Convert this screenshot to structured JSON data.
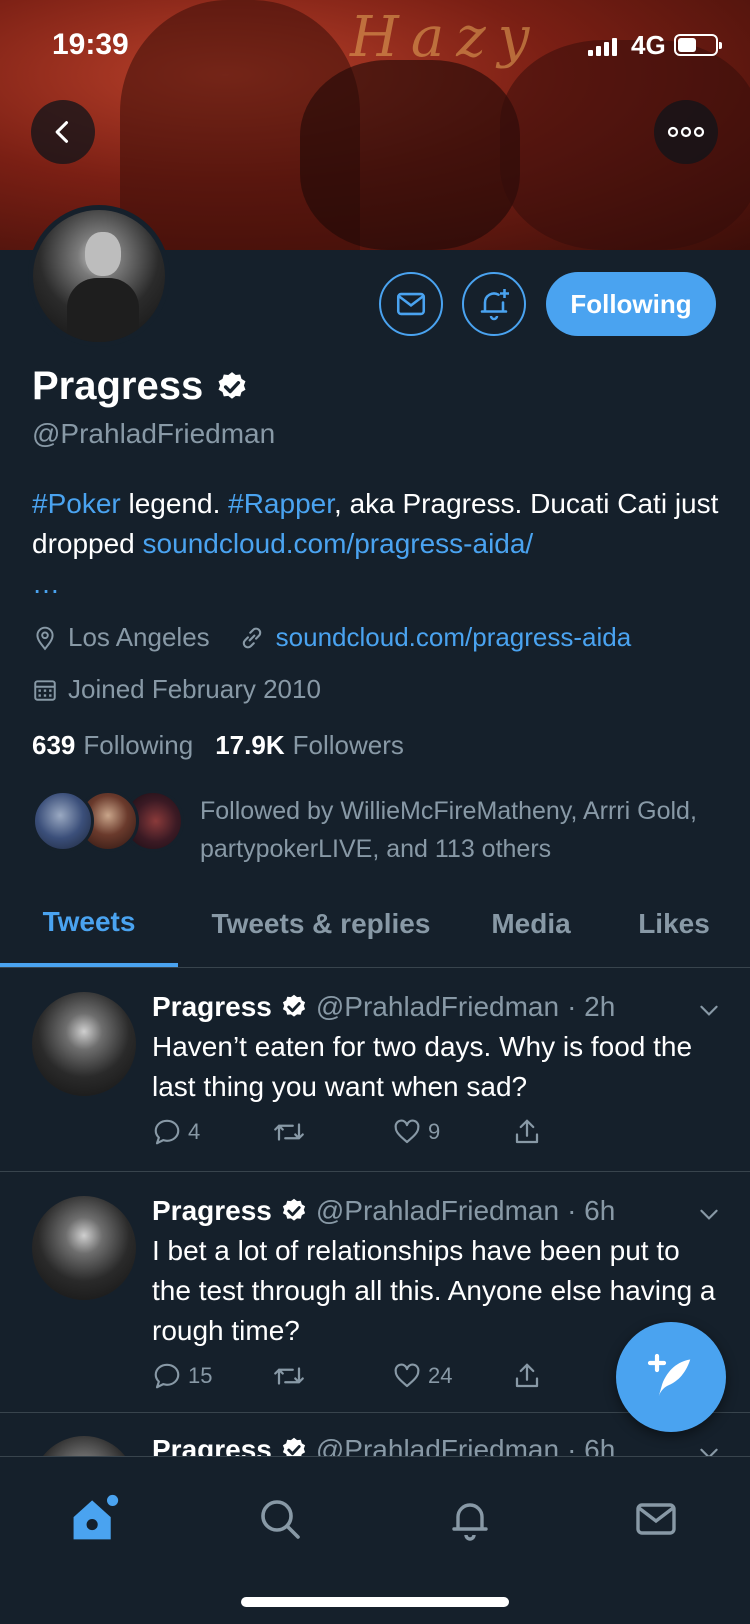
{
  "status_bar": {
    "time": "19:39",
    "network": "4G"
  },
  "profile": {
    "name": "Pragress",
    "handle": "@PrahladFriedman",
    "follow_button": "Following",
    "bio": {
      "hashtag1": "#Poker",
      "text1": " legend. ",
      "hashtag2": "#Rapper",
      "text2": ", aka Pragress. Ducati Cati just dropped ",
      "link": "soundcloud.com/pragress-aida/",
      "ellipsis": "…"
    },
    "location": "Los Angeles",
    "website": "soundcloud.com/pragress-aida",
    "joined": "Joined February 2010",
    "following_count": "639",
    "following_label": "Following",
    "followers_count": "17.9K",
    "followers_label": "Followers",
    "followed_by": "Followed by WillieMcFireMatheny, Arrri Gold, partypokerLIVE, and 113 others"
  },
  "tabs": [
    "Tweets",
    "Tweets & replies",
    "Media",
    "Likes"
  ],
  "tweets": [
    {
      "name": "Pragress",
      "handle": "@PrahladFriedman",
      "time": "· 2h",
      "text": "Haven’t eaten for two days. Why is food the last thing you want when sad?",
      "replies": "4",
      "retweets": "",
      "likes": "9"
    },
    {
      "name": "Pragress",
      "handle": "@PrahladFriedman",
      "time": "· 6h",
      "text": "I bet a lot of relationships have been put to the test through all this. Anyone else having a rough time?",
      "replies": "15",
      "retweets": "",
      "likes": "24"
    },
    {
      "name": "Pragress",
      "handle": "@PrahladFriedman",
      "time": "· 6h",
      "text": "",
      "replies": "",
      "retweets": "",
      "likes": ""
    }
  ],
  "bottom_nav": [
    "home-icon",
    "search-icon",
    "notifications-icon",
    "messages-icon"
  ],
  "colors": {
    "accent": "#4aa3f0",
    "background": "#15202b",
    "muted": "#8899a6",
    "divider": "#38444d"
  }
}
